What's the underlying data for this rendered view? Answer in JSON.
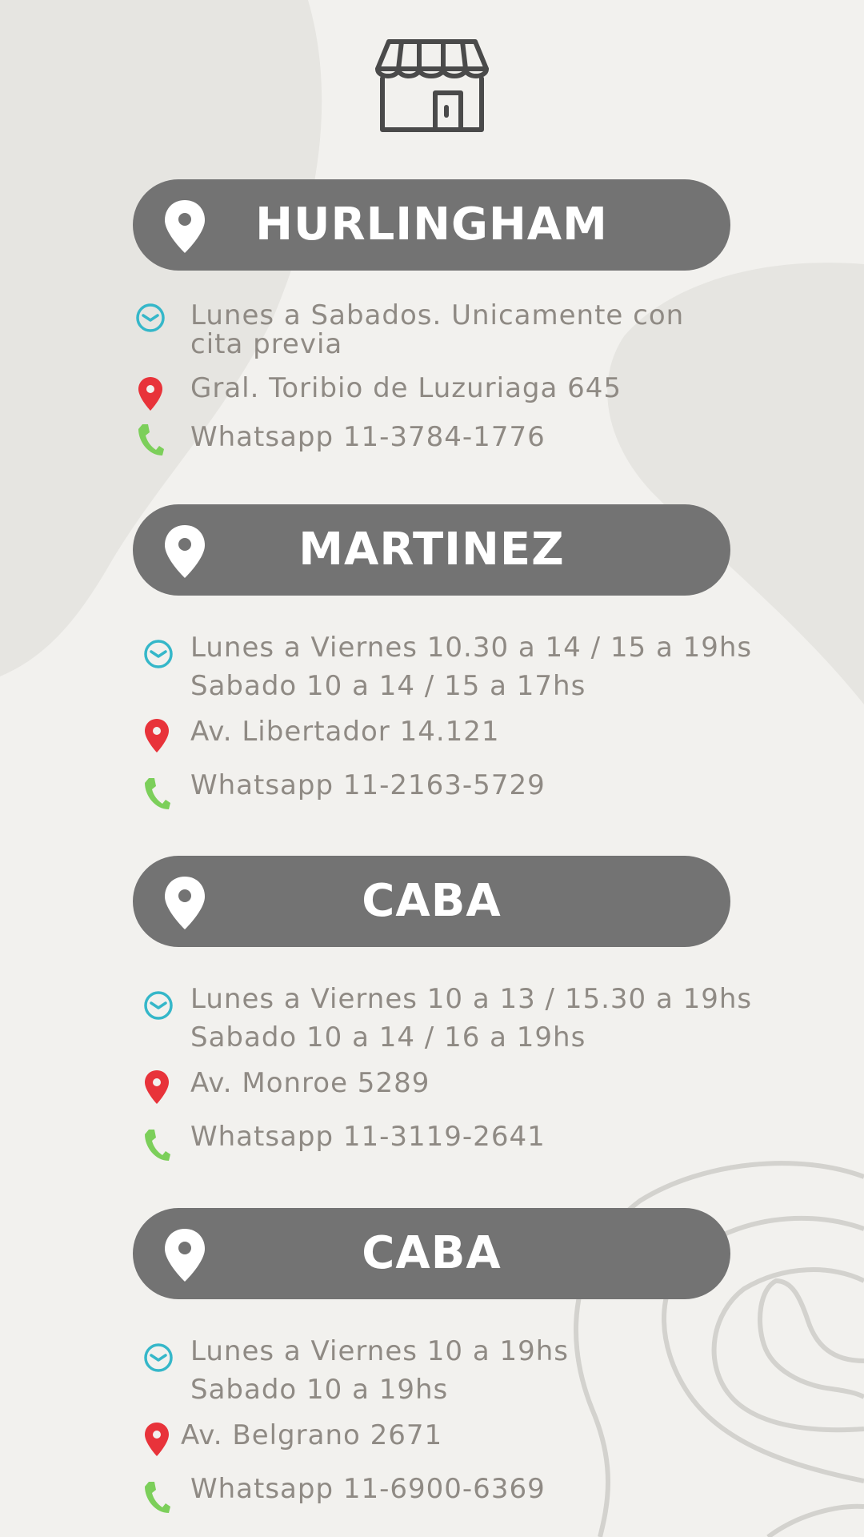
{
  "colors": {
    "background": "#f2f1ee",
    "blob": "#e6e5e1",
    "pill": "#737373",
    "text": "#8f8a84",
    "clock": "#35b7c9",
    "pin": "#e8333a",
    "phone": "#7ccf5a"
  },
  "icons": {
    "header": "storefront-icon",
    "pill": "location-pin-icon",
    "hours": "clock-icon",
    "address": "location-pin-icon",
    "phone": "phone-icon"
  },
  "locations": [
    {
      "name": "HURLINGHAM",
      "hours_line1": "Lunes a Sabados. Unicamente con",
      "hours_line2": "cita previa",
      "address": "Gral. Toribio de Luzuriaga 645",
      "phone": "Whatsapp 11-3784-1776"
    },
    {
      "name": "MARTINEZ",
      "hours_line1": "Lunes a Viernes 10.30 a 14 / 15 a 19hs",
      "hours_line2": "Sabado 10 a 14 / 15 a 17hs",
      "address": "Av. Libertador 14.121",
      "phone": "Whatsapp 11-2163-5729"
    },
    {
      "name": "CABA",
      "hours_line1": "Lunes a Viernes 10 a 13 / 15.30 a 19hs",
      "hours_line2": "Sabado 10 a 14 / 16 a 19hs",
      "address": "Av. Monroe 5289",
      "phone": "Whatsapp 11-3119-2641"
    },
    {
      "name": "CABA",
      "hours_line1": "Lunes a Viernes 10 a 19hs",
      "hours_line2": "Sabado 10 a 19hs",
      "address": "Av. Belgrano 2671",
      "phone": "Whatsapp 11-6900-6369"
    }
  ]
}
